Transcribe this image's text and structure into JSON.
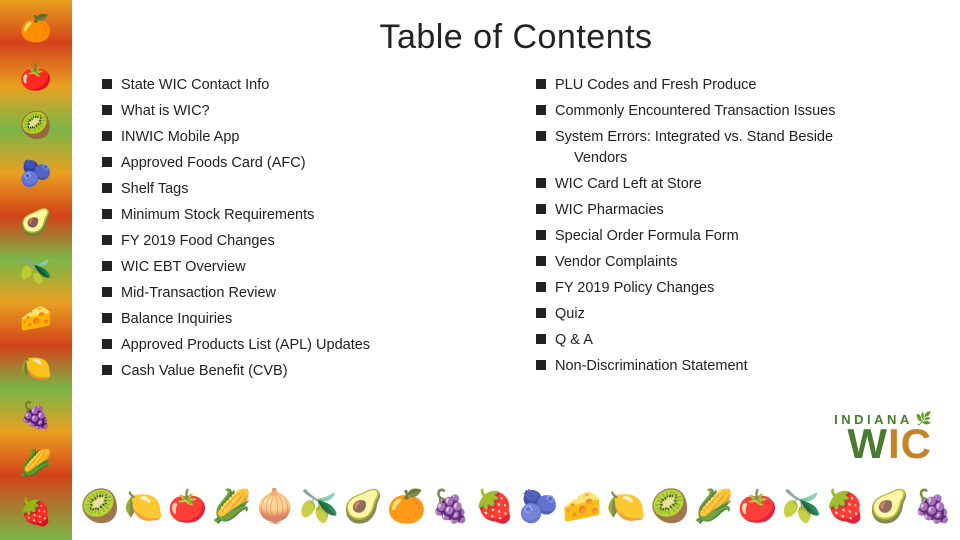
{
  "page": {
    "title": "Table of Contents",
    "left_column": [
      "State WIC Contact Info",
      "What is WIC?",
      "INWIC Mobile App",
      "Approved Foods Card (AFC)",
      "Shelf Tags",
      "Minimum Stock Requirements",
      "FY 2019 Food Changes",
      "WIC EBT Overview",
      "Mid-Transaction Review",
      "Balance Inquiries",
      "Approved Products List (APL) Updates",
      "Cash Value Benefit (CVB)"
    ],
    "right_column": [
      "PLU Codes and Fresh Produce",
      "Commonly Encountered Transaction Issues",
      "System Errors: Integrated vs. Stand Beside Vendors",
      "WIC Card Left at Store",
      "WIC Pharmacies",
      "Special Order Formula Form",
      "Vendor Complaints",
      "FY 2019 Policy Changes",
      "Quiz",
      "Q & A",
      "Non-Discrimination Statement"
    ],
    "right_column_indent": [
      false,
      false,
      false,
      true,
      true,
      true,
      true,
      true,
      true,
      true,
      true
    ],
    "food_emojis": [
      "🍊",
      "🍅",
      "🥝",
      "🫐",
      "🥑",
      "🫒",
      "🧀",
      "🍋",
      "🍇",
      "🌽",
      "🍓"
    ],
    "bottom_food_emojis": [
      "🥝",
      "🍋",
      "🍅",
      "🌽",
      "🧅",
      "🫒",
      "🥑",
      "🍊",
      "🍇",
      "🍓",
      "🫐"
    ],
    "logo": {
      "indiana": "INDIANA",
      "wic": "WIC"
    }
  }
}
